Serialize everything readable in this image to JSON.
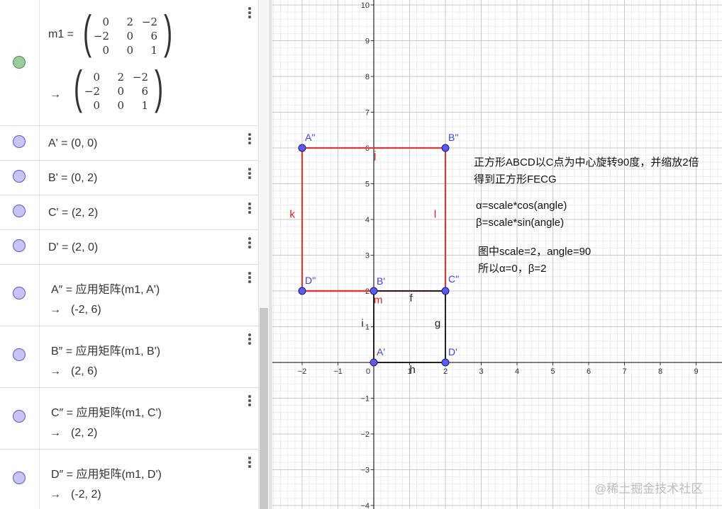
{
  "algebra_view": {
    "matrix_entry": {
      "name_label": "m1 =",
      "definition_rows": [
        [
          "0",
          "2",
          "−2"
        ],
        [
          "−2",
          "0",
          "6"
        ],
        [
          "0",
          "0",
          "1"
        ]
      ],
      "output_arrow": "→",
      "output_rows": [
        [
          "0",
          "2",
          "−2"
        ],
        [
          "−2",
          "0",
          "6"
        ],
        [
          "0",
          "0",
          "1"
        ]
      ]
    },
    "points": [
      {
        "text": "A' = (0, 0)"
      },
      {
        "text": "B' = (0, 2)"
      },
      {
        "text": "C' = (2, 2)"
      },
      {
        "text": "D' = (2, 0)"
      }
    ],
    "derived": [
      {
        "definition": "A″ = 应用矩阵(m1, A')",
        "arrow": "→",
        "value": "(-2, 6)"
      },
      {
        "definition": "B″ = 应用矩阵(m1, B')",
        "arrow": "→",
        "value": "(2, 6)"
      },
      {
        "definition": "C″ = 应用矩阵(m1, C')",
        "arrow": "→",
        "value": "(2, 2)"
      },
      {
        "definition": "D″ = 应用矩阵(m1, D')",
        "arrow": "→",
        "value": "(-2, 2)"
      }
    ],
    "colors": {
      "point_fill": "#c8c4f4",
      "point_stroke": "#5959c8",
      "matrix_marker": "#9ccc9c"
    }
  },
  "graphics_view": {
    "x_ticks": [
      "−2",
      "−1",
      "0",
      "1",
      "2",
      "3",
      "4",
      "5",
      "6",
      "7",
      "8",
      "9"
    ],
    "y_ticks": [
      "10",
      "9",
      "8",
      "7",
      "6",
      "5",
      "4",
      "3",
      "2",
      "1",
      "−1",
      "−2",
      "−3",
      "−4"
    ],
    "origin_label": "0",
    "point_labels": {
      "A2": "A''",
      "B2": "B''",
      "C2": "C''",
      "D2": "D''",
      "A1": "A'",
      "B1": "B'",
      "D1": "D'"
    },
    "segment_labels": {
      "j": "j",
      "k": "k",
      "l": "l",
      "m": "m",
      "f": "f",
      "g": "g",
      "h": "h",
      "i": "i"
    },
    "colors": {
      "red_square": "#d83a3a",
      "black_square": "#222222",
      "point_fill": "#5b5bf0",
      "point_label": "#4444cc",
      "red_label": "#d81e1e",
      "grid_major": "#c9c9c9",
      "grid_minor": "#ececec"
    },
    "notes": {
      "line1": "正方形ABCD以C点为中心旋转90度，并缩放2倍",
      "line2": "得到正方形FECG",
      "line3": "α=scale*cos(angle)",
      "line4": "β=scale*sin(angle)",
      "line5": "图中scale=2，angle=90",
      "line6": "所以α=0，β=2"
    }
  },
  "watermark": "@稀土掘金技术社区"
}
